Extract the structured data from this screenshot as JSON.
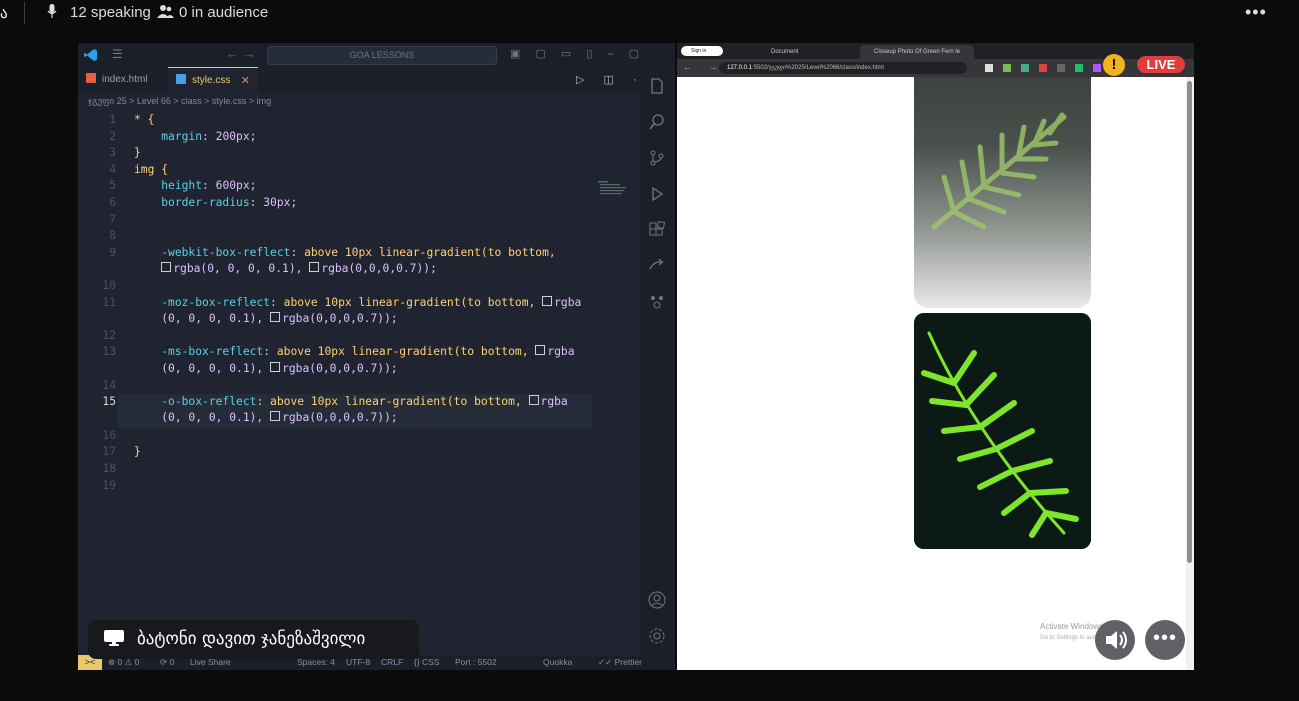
{
  "topbar": {
    "edge_glyph": "ა",
    "speaking": "12 speaking",
    "audience": "0 in audience",
    "more": "•••"
  },
  "vscode": {
    "menu": "☰",
    "nav": "←  →",
    "search": "GOA LESSONS",
    "tabs": [
      {
        "label": "index.html"
      },
      {
        "label": "style.css",
        "close": "✕"
      }
    ],
    "tab_actions": "▷ ◫ ···",
    "breadcrumb": "ჯგუფი 25 > Level 66 > class > style.css > img",
    "lines": [
      {
        "n": "1"
      },
      {
        "n": "2"
      },
      {
        "n": "3"
      },
      {
        "n": "4"
      },
      {
        "n": "5"
      },
      {
        "n": "6"
      },
      {
        "n": "7"
      },
      {
        "n": "8"
      },
      {
        "n": "9"
      },
      {
        "n": ""
      },
      {
        "n": "10"
      },
      {
        "n": "11"
      },
      {
        "n": ""
      },
      {
        "n": "12"
      },
      {
        "n": "13"
      },
      {
        "n": ""
      },
      {
        "n": "14"
      },
      {
        "n": "15"
      },
      {
        "n": ""
      },
      {
        "n": "16"
      },
      {
        "n": "17"
      },
      {
        "n": "18"
      },
      {
        "n": "19"
      }
    ],
    "code": {
      "l1_sel": "* {",
      "l2_prop": "margin",
      "l2_val": "200px",
      "l3": "}",
      "l4_sel": "img {",
      "l5_prop": "height",
      "l5_val": "600px",
      "l6_prop": "border-radius",
      "l6_val": "30px",
      "l9_prop": "-webkit-box-reflect",
      "l9_rest": "above 10px linear-gradient(to bottom,",
      "l9b_a": "rgba(0, 0, 0, 0.1),",
      "l9b_b": "rgba(0,0,0,0.7));",
      "l11_prop": "-moz-box-reflect",
      "l11_rest": "above 10px linear-gradient(to bottom,",
      "l11_rgba": "rgba",
      "l11b_a": "(0, 0, 0, 0.1),",
      "l11b_b": "rgba(0,0,0,0.7));",
      "l13_prop": "-ms-box-reflect",
      "l13_rest": "above 10px linear-gradient(to bottom,",
      "l13_rgba": "rgba",
      "l13b_a": "(0, 0, 0, 0.1),",
      "l13b_b": "rgba(0,0,0,0.7));",
      "l15_prop": "-o-box-reflect",
      "l15_rest": "above 10px linear-gradient(to bottom,",
      "l15_rgba": "rgba",
      "l15b_a": "(0, 0, 0, 0.1),",
      "l15b_b": "rgba(0,0,0,0.7));",
      "l17": "}"
    },
    "status": {
      "remote": "><",
      "errors": "⊗ 0 ⚠ 0",
      "ports": "⟳ 0",
      "live_share": "Live Share",
      "spaces": "Spaces: 4",
      "encoding": "UTF-8",
      "eol": "CRLF",
      "lang": "{} CSS",
      "port": "Port : 5502",
      "quokka": "Quokka",
      "prettier": "✓✓ Prettier"
    }
  },
  "notice": {
    "name": "ბატონი დავით ჯანეზაშვილი"
  },
  "browser": {
    "tabs": [
      {
        "label": "Sign in"
      },
      {
        "label": "Document"
      },
      {
        "label": "Closeup Photo Of Green Fern le"
      }
    ],
    "url_host": "127.0.0.1",
    "url_path": ":5502/ჯგუფი%2025/Level%2066/class/index.html",
    "live": "LIVE",
    "warn": "!"
  },
  "activate": {
    "title": "Activate Windows",
    "sub": "Go to Settings to activate Windows."
  },
  "controls": {
    "more": "•••"
  },
  "colors": {
    "editor_bg": "#1f2430",
    "accent": "#e8c86b",
    "live_red": "#e23c3c"
  }
}
